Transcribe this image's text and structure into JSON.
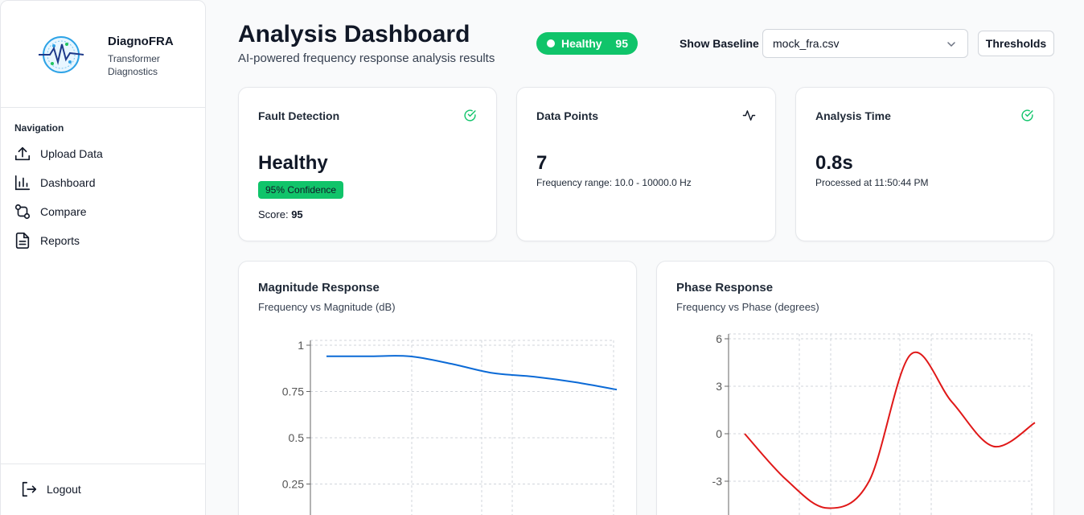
{
  "sidebar": {
    "brand_name": "DiagnoFRA",
    "brand_sub": "Transformer Diagnostics",
    "nav_heading": "Navigation",
    "items": [
      {
        "label": "Upload Data",
        "icon": "upload-icon"
      },
      {
        "label": "Dashboard",
        "icon": "bar-chart-icon"
      },
      {
        "label": "Compare",
        "icon": "compare-icon"
      },
      {
        "label": "Reports",
        "icon": "document-icon"
      }
    ],
    "logout_label": "Logout"
  },
  "header": {
    "title": "Analysis Dashboard",
    "subtitle": "AI-powered frequency response analysis results",
    "status_label": "Healthy",
    "status_score": "95",
    "baseline_label": "Show Baseline",
    "baseline_value": "mock_fra.csv",
    "thresholds_label": "Thresholds"
  },
  "cards": {
    "fault": {
      "title": "Fault Detection",
      "value": "Healthy",
      "badge": "95% Confidence",
      "score_label": "Score:",
      "score_value": "95"
    },
    "points": {
      "title": "Data Points",
      "value": "7",
      "detail": "Frequency range: 10.0 - 10000.0 Hz"
    },
    "time": {
      "title": "Analysis Time",
      "value": "0.8s",
      "detail": "Processed at 11:50:44 PM"
    }
  },
  "colors": {
    "accent_green": "#10c46a",
    "magnitude_line": "#0b6ad6",
    "phase_line": "#e01818"
  },
  "chart_data": [
    {
      "type": "line",
      "title": "Magnitude Response",
      "subtitle": "Frequency vs Magnitude (dB)",
      "ylim": [
        0,
        1
      ],
      "yticks": [
        "1",
        "0.75",
        "0.5",
        "0.25"
      ],
      "grid": true,
      "series": [
        {
          "values": [
            0.94,
            0.94,
            0.94,
            0.9,
            0.85,
            0.83,
            0.8,
            0.76
          ]
        }
      ]
    },
    {
      "type": "line",
      "title": "Phase Response",
      "subtitle": "Frequency vs Phase (degrees)",
      "ylim": [
        -6,
        6
      ],
      "yticks": [
        "6",
        "3",
        "0",
        "-3"
      ],
      "grid": true,
      "series": [
        {
          "values": [
            0,
            -2.9,
            -4.7,
            -3.0,
            5.0,
            2.0,
            -0.8,
            0.7
          ]
        }
      ]
    }
  ]
}
